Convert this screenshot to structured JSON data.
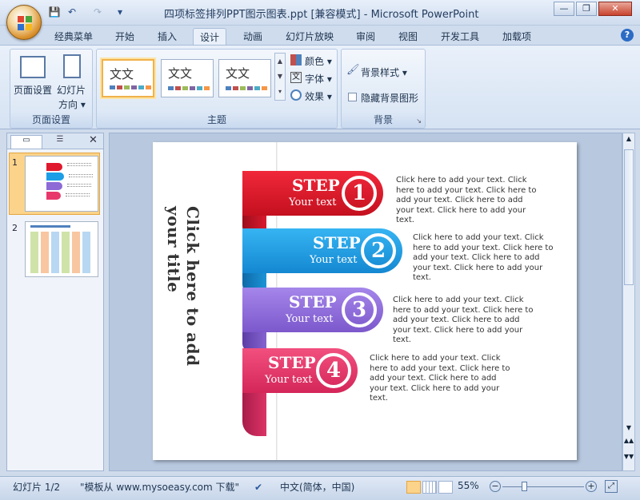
{
  "window": {
    "title": "四项标签排列PPT图示图表.ppt [兼容模式] - Microsoft PowerPoint",
    "minimize": "—",
    "restore": "❐",
    "close": "✕"
  },
  "quick_access": {
    "save": "💾",
    "undo": "↶",
    "redo": "↷",
    "more": "▾"
  },
  "tabs": [
    "经典菜单",
    "开始",
    "插入",
    "设计",
    "动画",
    "幻灯片放映",
    "审阅",
    "视图",
    "开发工具",
    "加载项"
  ],
  "active_tab": "设计",
  "ribbon": {
    "page_setup": {
      "page_setup_label": "页面设置",
      "orientation_label": "幻灯片",
      "orientation_label2": "方向",
      "group": "页面设置"
    },
    "themes": {
      "thumbs": [
        "文文",
        "文文",
        "文文"
      ],
      "colors": "颜色",
      "fonts": "字体",
      "effects": "效果",
      "group": "主题"
    },
    "background": {
      "styles": "背景样式",
      "hide": "隐藏背景图形",
      "group": "背景"
    }
  },
  "slides_pane": {
    "numbers": [
      "1",
      "2"
    ]
  },
  "slide": {
    "title": "Click here to add your title",
    "steps": [
      {
        "label": "STEP",
        "sub": "Your text",
        "num": "1",
        "color": "#e0182d",
        "text": "Click here to add your text. Click here to add your text. Click here to add your text. Click here to add your text. Click here to add your text."
      },
      {
        "label": "STEP",
        "sub": "Your text",
        "num": "2",
        "color": "#1b9ee6",
        "text": "Click here to add your text. Click here to add your text. Click here to add your text. Click here to add your text. Click here to add your text."
      },
      {
        "label": "STEP",
        "sub": "Your text",
        "num": "3",
        "color": "#8d6ad6",
        "text": "Click here to add your text. Click here to add your text. Click here to add your text. Click here to add your text. Click here to add your text."
      },
      {
        "label": "STEP",
        "sub": "Your text",
        "num": "4",
        "color": "#e8386b",
        "text": "Click here to add your text. Click here to add your text. Click here to add your text. Click here to add your text. Click here to add your text."
      }
    ]
  },
  "status": {
    "slide": "幻灯片 1/2",
    "template": "\"模板从 www.mysoeasy.com 下载\"",
    "language": "中文(简体，中国)",
    "zoom": "55%"
  }
}
